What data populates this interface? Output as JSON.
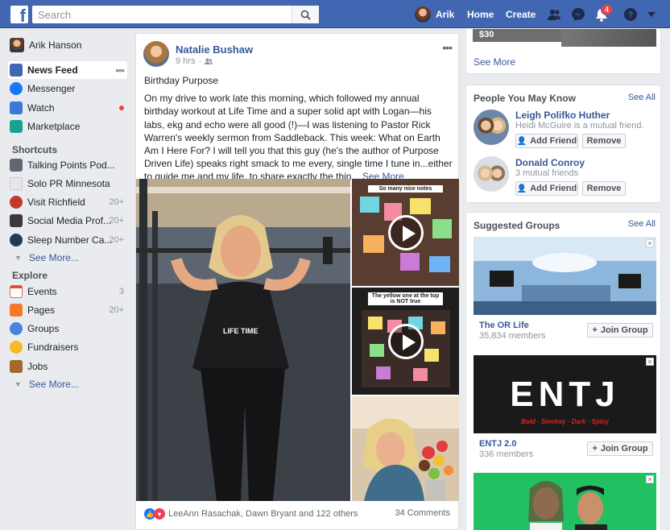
{
  "topbar": {
    "logo": "f",
    "search_placeholder": "Search",
    "user_name": "Arik",
    "nav_home": "Home",
    "nav_create": "Create",
    "notif_count": "4"
  },
  "left_nav": {
    "profile": "Arik Hanson",
    "main": [
      {
        "label": "News Feed",
        "icon": "news-feed-icon",
        "color": "#4267b2"
      },
      {
        "label": "Messenger",
        "icon": "messenger-icon",
        "color": "#1877f2"
      },
      {
        "label": "Watch",
        "icon": "watch-icon",
        "color": "#3b79d8"
      },
      {
        "label": "Marketplace",
        "icon": "marketplace-icon",
        "color": "#1aa38c"
      }
    ],
    "shortcuts_title": "Shortcuts",
    "shortcuts": [
      {
        "label": "Talking Points Pod...",
        "count": ""
      },
      {
        "label": "Solo PR Minnesota",
        "count": ""
      },
      {
        "label": "Visit Richfield",
        "count": "20+"
      },
      {
        "label": "Social Media Prof...",
        "count": "20+"
      },
      {
        "label": "Sleep Number Ca...",
        "count": "20+"
      }
    ],
    "see_more_1": "See More...",
    "explore_title": "Explore",
    "explore": [
      {
        "label": "Events",
        "count": "3",
        "icon": "events-icon"
      },
      {
        "label": "Pages",
        "count": "20+",
        "icon": "pages-icon"
      },
      {
        "label": "Groups",
        "count": "",
        "icon": "groups-icon"
      },
      {
        "label": "Fundraisers",
        "count": "",
        "icon": "fundraisers-icon"
      },
      {
        "label": "Jobs",
        "count": "",
        "icon": "jobs-icon"
      }
    ],
    "see_more_2": "See More..."
  },
  "post": {
    "author": "Natalie Bushaw",
    "time": "9 hrs",
    "title_line": "Birthday Purpose",
    "body": "On my drive to work late this morning, which followed my annual birthday workout at Life Time and a super solid apt with Logan—his labs, ekg and echo were all good (!)—I was listening to Pastor Rick Warren's weekly sermon from Saddleback. This week: What on Earth Am I Here For? I will tell you that this guy (he's the author of Purpose Driven Life) speaks right smack to me every, single time I tune in...either to guide me and my life, to share exactly the thin...",
    "see_more": "See More",
    "thumb1_caption": "So many nice notes",
    "thumb2_caption": "The yellow one at the top is NOT true",
    "reactions_text": "LeeAnn Rasachak, Dawn Bryant and 122 others",
    "comments_text": "34 Comments"
  },
  "right": {
    "top_card": {
      "price": "$30",
      "see_more": "See More"
    },
    "pymk": {
      "title": "People You May Know",
      "see_all": "See All",
      "people": [
        {
          "name": "Leigh Polifko Huther",
          "sub": "Heidi McGuire is a mutual friend."
        },
        {
          "name": "Donald Conroy",
          "sub": "3 mutual friends"
        }
      ],
      "add_label": "Add Friend",
      "remove_label": "Remove"
    },
    "groups": {
      "title": "Suggested Groups",
      "see_all": "See All",
      "items": [
        {
          "name": "The OR Life",
          "members": "35,834 members"
        },
        {
          "name": "ENTJ 2.0",
          "members": "336 members"
        }
      ],
      "join_label": "Join Group",
      "entj_banner": "ENTJ",
      "entj_sub": "Bold · Smokey · Dark · Spicy"
    }
  }
}
